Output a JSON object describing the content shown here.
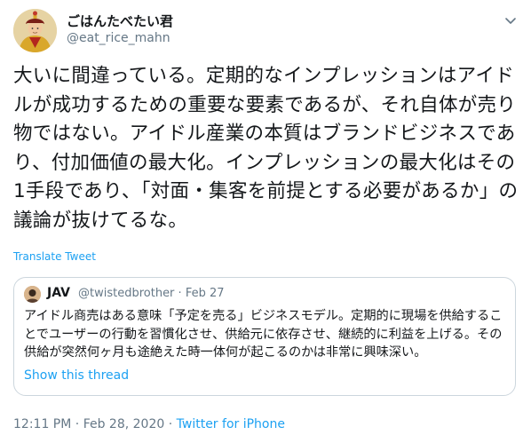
{
  "author": {
    "display_name": "ごはんたべたい君",
    "handle": "@eat_rice_mahn",
    "avatar_icon": "emperor-portrait-avatar"
  },
  "tweet": {
    "text": "大いに間違っている。定期的なインプレッションはアイドルが成功するための重要な要素であるが、それ自体が売り物ではない。アイドル産業の本質はブランドビジネスであり、付加価値の最大化。インプレッションの最大化はその1手段であり、「対面・集客を前提とする必要があるか」の議論が抜けてるな。",
    "translate_label": "Translate Tweet"
  },
  "quoted_tweet": {
    "display_name": "JAV",
    "handle": "@twistedbrother",
    "separator": "·",
    "date": "Feb 27",
    "text": "アイドル商売はある意味「予定を売る」ビジネスモデル。定期的に現場を供給することでユーザーの行動を習慣化させ、供給元に依存させ、継続的に利益を上げる。その供給が突然何ヶ月も途絶えた時一体何が起こるのかは非常に興味深い。",
    "show_thread_label": "Show this thread",
    "avatar_icon": "user-avatar"
  },
  "footer": {
    "time": "12:11 PM",
    "separator": "·",
    "date": "Feb 28, 2020",
    "source": "Twitter for iPhone"
  },
  "colors": {
    "link": "#1da1f2",
    "muted": "#657786",
    "text": "#14171a",
    "border": "#ccd6dd"
  }
}
